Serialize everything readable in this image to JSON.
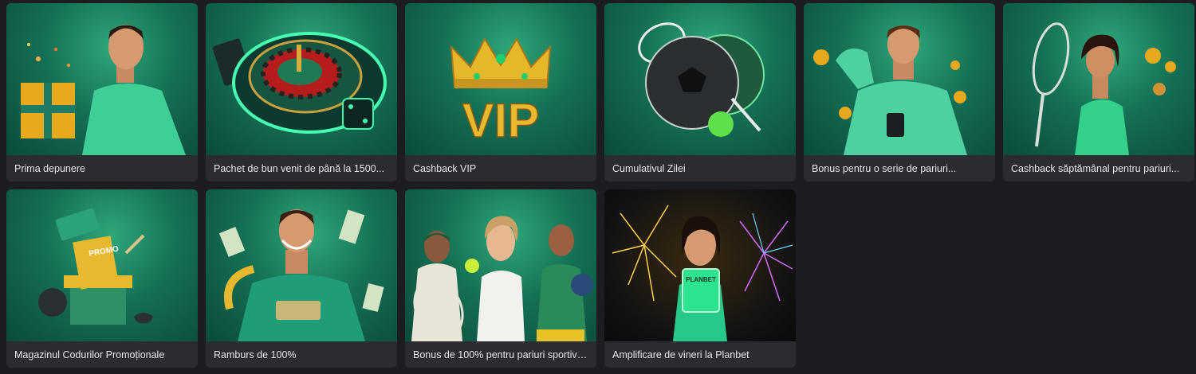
{
  "promotions": [
    {
      "title": "Prima depunere",
      "icon": "gift-player-icon"
    },
    {
      "title": "Pachet de bun venit de până la 1500...",
      "icon": "roulette-icon"
    },
    {
      "title": "Cashback VIP",
      "icon": "vip-crown-icon"
    },
    {
      "title": "Cumulativul Zilei",
      "icon": "sports-balls-icon"
    },
    {
      "title": "Bonus pentru o serie de pariuri...",
      "icon": "phone-player-icon"
    },
    {
      "title": "Cashback săptămânal pentru pariuri...",
      "icon": "tennis-player-icon"
    },
    {
      "title": "Magazinul Codurilor Promoționale",
      "icon": "promo-box-icon"
    },
    {
      "title": "Ramburs de 100%",
      "icon": "money-player-icon"
    },
    {
      "title": "Bonus de 100% pentru pariuri sportive...",
      "icon": "athletes-icon"
    },
    {
      "title": "Amplificare de vineri la Planbet",
      "icon": "fireworks-icon"
    }
  ],
  "art_text": {
    "vip": "VIP",
    "promo": "PROMO",
    "planbet": "PLANBET"
  },
  "colors": {
    "background": "#1c1d21",
    "card": "#2a2c32",
    "accent_green": "#1f8a66",
    "gold": "#e8b92e"
  }
}
